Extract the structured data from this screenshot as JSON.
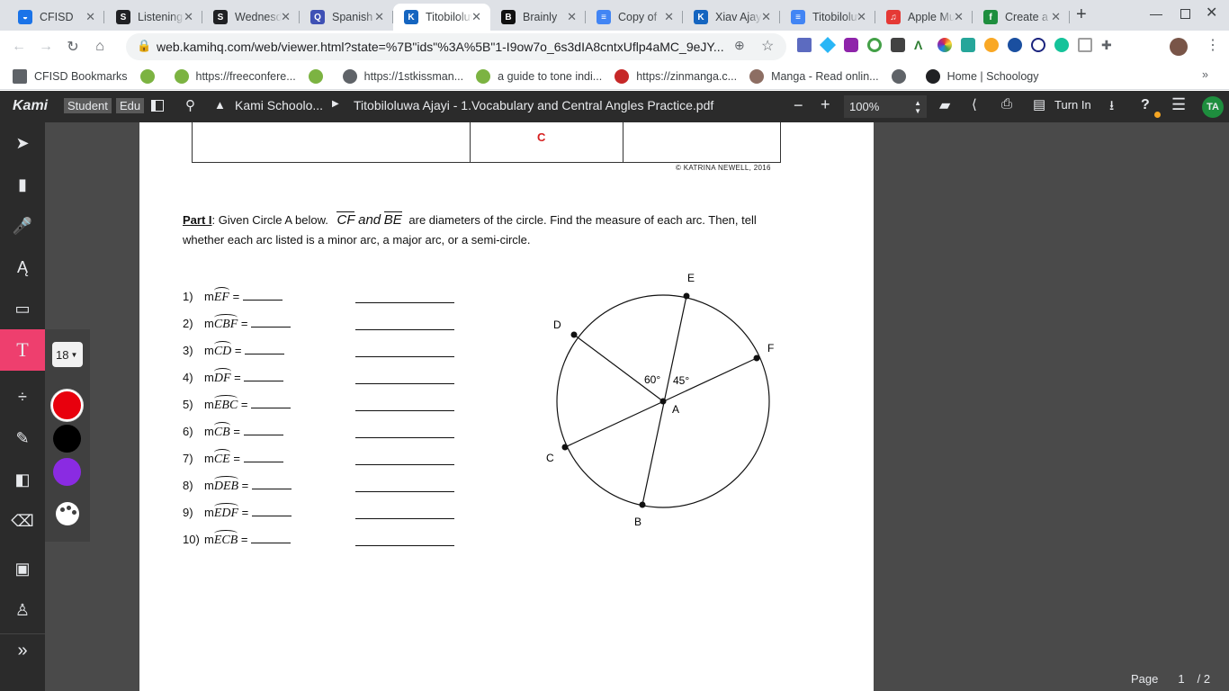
{
  "tabs": [
    {
      "label": "CFISD",
      "color": "#1a73e8",
      "glyph": "◒"
    },
    {
      "label": "Listening",
      "color": "#202124",
      "glyph": "S"
    },
    {
      "label": "Wednesday",
      "color": "#202124",
      "glyph": "S"
    },
    {
      "label": "Spanish",
      "color": "#3f51b5",
      "glyph": "Q"
    },
    {
      "label": "Titobiloluwa",
      "color": "#1565c0",
      "glyph": "K"
    },
    {
      "label": "Brainly",
      "color": "#111111",
      "glyph": "B"
    },
    {
      "label": "Copy of",
      "color": "#4285f4",
      "glyph": "≡"
    },
    {
      "label": "Xiav Ajayi",
      "color": "#1565c0",
      "glyph": "K"
    },
    {
      "label": "Titobiloluwa",
      "color": "#4285f4",
      "glyph": "≡"
    },
    {
      "label": "Apple Music",
      "color": "#e53935",
      "glyph": "♫"
    },
    {
      "label": "Create a",
      "color": "#1e8e3e",
      "glyph": "f"
    }
  ],
  "address": "web.kamihq.com/web/viewer.html?state=%7B\"ids\"%3A%5B\"1-I9ow7o_6s3dIA8cntxUflp4aMC_9eJY...",
  "bookmarks": [
    {
      "label": "CFISD Bookmarks",
      "color": "#5f6368"
    },
    {
      "label": "",
      "color": "#7cb342"
    },
    {
      "label": "https://freeconfere...",
      "color": "#7cb342"
    },
    {
      "label": "",
      "color": "#7cb342"
    },
    {
      "label": "https://1stkissman...",
      "color": "#5f6368"
    },
    {
      "label": "a guide to tone indi...",
      "color": "#7cb342"
    },
    {
      "label": "https://zinmanga.c...",
      "color": "#c62828"
    },
    {
      "label": "Manga - Read onlin...",
      "color": "#8d6e63"
    },
    {
      "label": "",
      "color": "#5f6368"
    },
    {
      "label": "Home | Schoology",
      "color": "#202124"
    }
  ],
  "kami": {
    "logo": "Kami",
    "student": "Student",
    "edu": "Edu",
    "breadcrumb_folder": "Kami Schoolo...",
    "doc_title": "Titobiloluwa Ajayi - 1.Vocabulary and Central Angles Practice.pdf",
    "zoom": "100%",
    "turn_in": "Turn In",
    "avatar": "TA",
    "font_size": "18",
    "colors": [
      "#e8000d",
      "#000000",
      "#8a2be2"
    ],
    "page_label": "Page",
    "page_current": "1",
    "page_total": "/ 2"
  },
  "worksheet": {
    "table_cell": "C",
    "copyright": "© KATRINA NEWELL, 2016",
    "part_label": "Part I",
    "instructions_a": ":  Given Circle A below.",
    "diam1": "CF",
    "diam_and": "and",
    "diam2": "BE",
    "instructions_b": "are diameters of the circle.  Find the measure of each arc.  Then, tell",
    "instructions_c": "whether each arc listed is a minor arc, a major arc, or a semi-circle.",
    "questions": [
      {
        "num": "1)",
        "arc": "EF"
      },
      {
        "num": "2)",
        "arc": "CBF"
      },
      {
        "num": "3)",
        "arc": "CD"
      },
      {
        "num": "4)",
        "arc": "DF"
      },
      {
        "num": "5)",
        "arc": "EBC"
      },
      {
        "num": "6)",
        "arc": "CB"
      },
      {
        "num": "7)",
        "arc": "CE"
      },
      {
        "num": "8)",
        "arc": "DEB"
      },
      {
        "num": "9)",
        "arc": "EDF"
      },
      {
        "num": "10)",
        "arc": "ECB"
      }
    ],
    "diagram": {
      "points": {
        "E": "E",
        "D": "D",
        "F": "F",
        "A": "A",
        "C": "C",
        "B": "B"
      },
      "angle1": "60°",
      "angle2": "45°"
    }
  }
}
